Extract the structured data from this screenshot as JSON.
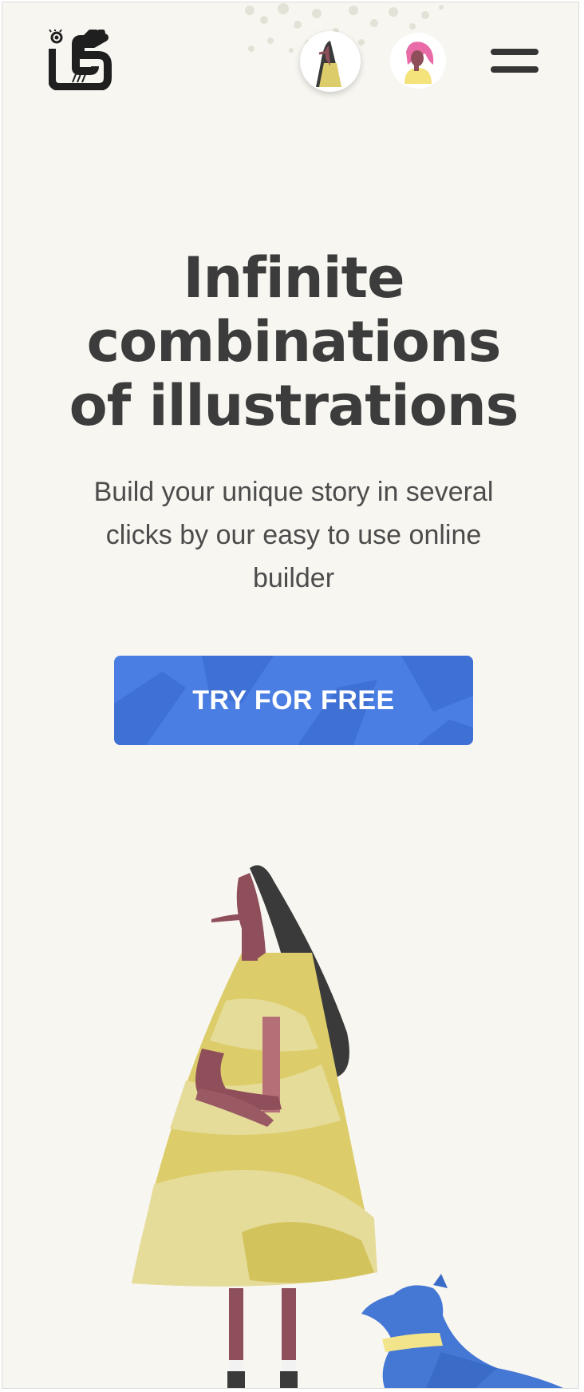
{
  "header": {
    "logo_icon": "brand-logo-icon",
    "avatars": [
      {
        "icon": "woman-dark-hair-avatar-icon"
      },
      {
        "icon": "woman-pink-hair-avatar-icon"
      }
    ],
    "menu_icon": "hamburger-menu-icon"
  },
  "hero": {
    "title_line1": "Infinite",
    "title_line2": "combinations",
    "title_line3": "of illustrations",
    "subtitle_line1": "Build your unique story in several",
    "subtitle_line2": "clicks by our easy to use online",
    "subtitle_line3": "builder",
    "cta_label": "TRY FOR FREE"
  },
  "colors": {
    "background": "#f8f6f1",
    "text_dark": "#3c3c3c",
    "cta_blue": "#4a7ee3",
    "dress_yellow": "#dccd6a",
    "skin": "#8f4f5a",
    "hair": "#3a3a3a",
    "dog_blue": "#4577d4"
  },
  "illustration": {
    "icon": "woman-with-dog-illustration"
  }
}
